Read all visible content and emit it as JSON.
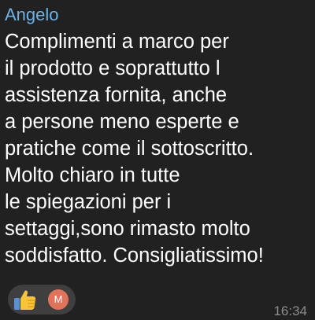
{
  "message": {
    "sender": "Angelo",
    "lines": [
      "Complimenti a marco per",
      "il prodotto e soprattutto l",
      "assistenza fornita, anche",
      "a persone meno esperte e",
      "pratiche come il sottoscritto.",
      "Molto chiaro in tutte",
      "le spiegazioni per i",
      "settaggi,sono rimasto molto",
      "soddisfatto. Consigliatissimo!"
    ],
    "time": "16:34"
  },
  "reaction": {
    "icon": "thumbs-up-icon",
    "avatar_initial": "M",
    "avatar_color": "#e1735b"
  },
  "colors": {
    "background": "#000000",
    "bubble": "#212121",
    "sender_name": "#6cb3e8",
    "text": "#ffffff",
    "timestamp": "#8c8c8c",
    "reaction_pill": "#3f3f3f"
  }
}
